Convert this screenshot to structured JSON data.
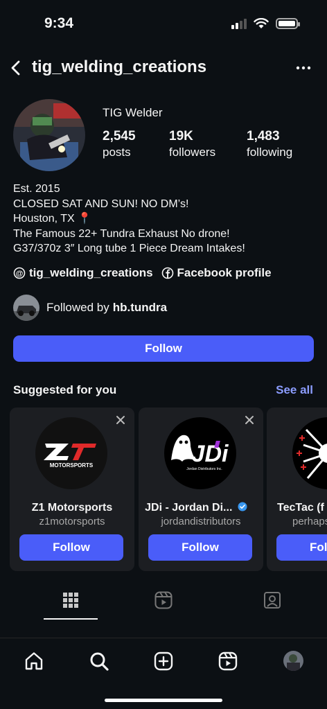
{
  "status_bar": {
    "time": "9:34",
    "icons": [
      "signal-icon",
      "wifi-icon",
      "battery-icon"
    ]
  },
  "header": {
    "username": "tig_welding_creations",
    "back_icon": "chevron-left-icon",
    "menu_icon": "more-dots-icon"
  },
  "profile": {
    "name": "TIG Welder",
    "stats": [
      {
        "value": "2,545",
        "label": "posts"
      },
      {
        "value": "19K",
        "label": "followers"
      },
      {
        "value": "1,483",
        "label": "following"
      }
    ],
    "bio": [
      "Est. 2015",
      "CLOSED SAT AND SUN! NO DM’s!",
      "Houston, TX 📍",
      "The Famous 22+ Tundra Exhaust No drone!",
      "G37/370z 3″ Long tube 1 Piece Dream Intakes!"
    ],
    "links": [
      {
        "icon": "threads-icon",
        "label": "tig_welding_creations"
      },
      {
        "icon": "facebook-icon",
        "label": "Facebook profile"
      }
    ],
    "followed_by_prefix": "Followed by",
    "followed_by_user": "hb.tundra",
    "follow_button": "Follow"
  },
  "suggested": {
    "title": "Suggested for you",
    "see_all": "See all",
    "cards": [
      {
        "name": "Z1 Motorsports",
        "handle": "z1motorsports",
        "follow": "Follow",
        "logo_text": "MOTORSPORTS",
        "verified": false
      },
      {
        "name": "JDi - Jordan Di...",
        "handle": "jordandistributors",
        "follow": "Follow",
        "logo_text": "JDi",
        "logo_subtext": "Jordan Distributors Inc.",
        "verified": true
      },
      {
        "name": "TecTac (f",
        "handle": "perhaps",
        "follow": "Fol",
        "verified": false
      }
    ]
  },
  "profile_tabs": [
    "grid-icon",
    "reels-icon",
    "tagged-icon"
  ],
  "bottom_nav": [
    "home-icon",
    "search-icon",
    "create-icon",
    "reels-icon",
    "profile-avatar"
  ],
  "colors": {
    "background": "#0c1014",
    "accent": "#4a5df9",
    "link": "#8c9dff",
    "card": "#1c1e22"
  }
}
